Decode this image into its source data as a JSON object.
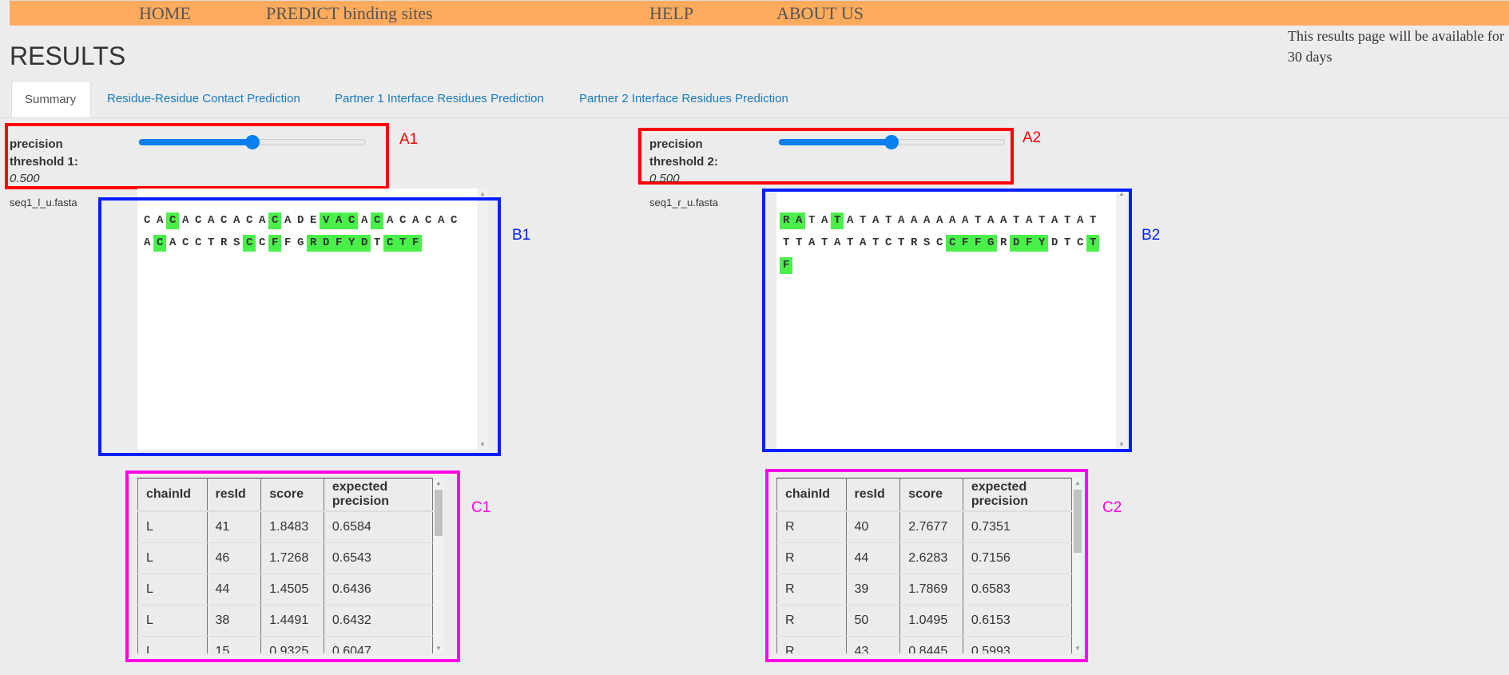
{
  "nav": {
    "items": [
      "HOME",
      "PREDICT binding sites",
      "HELP",
      "ABOUT US"
    ]
  },
  "availability_note": "This results page will be available for 30 days",
  "page_title": "RESULTS",
  "tabs": [
    {
      "label": "Summary",
      "active": true
    },
    {
      "label": "Residue-Residue Contact Prediction",
      "active": false
    },
    {
      "label": "Partner 1 Interface Residues Prediction",
      "active": false
    },
    {
      "label": "Partner 2 Interface Residues Prediction",
      "active": false
    }
  ],
  "colors": {
    "nav_bg": "#ffab5e",
    "highlight": "#4af04a",
    "slider": "#0a7ff0",
    "annotation_red": "#ff0000",
    "annotation_blue": "#0020ff",
    "annotation_magenta": "#ff00e8"
  },
  "panels": [
    {
      "threshold_label": "precision threshold 1:",
      "threshold_value": "0.500",
      "slider_fraction": 0.5,
      "fasta_name": "seq1_l_u.fasta",
      "annotations": {
        "a": "A1",
        "b": "B1",
        "c": "C1"
      },
      "sequence_lines": [
        [
          [
            "CA",
            0
          ],
          [
            "C",
            1
          ],
          [
            "ACACACA",
            0
          ],
          [
            "C",
            1
          ],
          [
            "ADE",
            0
          ],
          [
            "VAC",
            1
          ],
          [
            "A",
            0
          ],
          [
            "C",
            1
          ],
          [
            "ACACAC",
            0
          ]
        ],
        [
          [
            "A",
            0
          ],
          [
            "C",
            1
          ],
          [
            "ACCTRS",
            0
          ],
          [
            "C",
            1
          ],
          [
            "C",
            0
          ],
          [
            "F",
            1
          ],
          [
            "FG",
            0
          ],
          [
            "RDFYD",
            1
          ],
          [
            "T",
            0
          ],
          [
            "CTF",
            1
          ]
        ]
      ],
      "table": {
        "columns": [
          "chainId",
          "resId",
          "score",
          "expected precision"
        ],
        "rows": [
          [
            "L",
            "41",
            "1.8483",
            "0.6584"
          ],
          [
            "L",
            "46",
            "1.7268",
            "0.6543"
          ],
          [
            "L",
            "44",
            "1.4505",
            "0.6436"
          ],
          [
            "L",
            "38",
            "1.4491",
            "0.6432"
          ],
          [
            "L",
            "15",
            "0.9325",
            "0.6047"
          ]
        ]
      }
    },
    {
      "threshold_label": "precision threshold 2:",
      "threshold_value": "0.500",
      "slider_fraction": 0.5,
      "fasta_name": "seq1_r_u.fasta",
      "annotations": {
        "a": "A2",
        "b": "B2",
        "c": "C2"
      },
      "sequence_lines": [
        [
          [
            "RA",
            1
          ],
          [
            "TA",
            0
          ],
          [
            "T",
            1
          ],
          [
            "ATATAAAAAATAATATATAT",
            0
          ]
        ],
        [
          [
            "TTATATATCTRSC",
            0
          ],
          [
            "CFFG",
            1
          ],
          [
            "R",
            0
          ],
          [
            "DFY",
            1
          ],
          [
            "DTC",
            0
          ],
          [
            "T",
            1
          ]
        ],
        [
          [
            "F",
            1
          ]
        ]
      ],
      "table": {
        "columns": [
          "chainId",
          "resId",
          "score",
          "expected precision"
        ],
        "rows": [
          [
            "R",
            "40",
            "2.7677",
            "0.7351"
          ],
          [
            "R",
            "44",
            "2.6283",
            "0.7156"
          ],
          [
            "R",
            "39",
            "1.7869",
            "0.6583"
          ],
          [
            "R",
            "50",
            "1.0495",
            "0.6153"
          ],
          [
            "R",
            "43",
            "0.8445",
            "0.5993"
          ]
        ]
      }
    }
  ]
}
